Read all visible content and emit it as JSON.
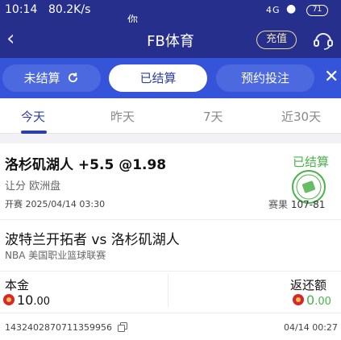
{
  "status_bar": {
    "time": "10:14",
    "speed": "80.2K/s",
    "overlay_text": "你",
    "signal": "4G",
    "battery": "71"
  },
  "header": {
    "title": "FB体育",
    "recharge_label": "充值",
    "back_icon": "chevron-left-icon",
    "service_icon": "headset-icon"
  },
  "filters": {
    "items": [
      {
        "label": "未结算",
        "active": false
      },
      {
        "label": "已结算",
        "active": true
      },
      {
        "label": "预约投注",
        "active": false
      }
    ],
    "close_icon": "close-icon"
  },
  "date_tabs": [
    {
      "label": "今天",
      "active": true
    },
    {
      "label": "昨天",
      "active": false
    },
    {
      "label": "7天",
      "active": false
    },
    {
      "label": "近30天",
      "active": false
    }
  ],
  "bet": {
    "selection": "洛杉矶湖人 +5.5 @1.98",
    "status": "已结算",
    "bet_type": "让分 欧洲盘",
    "start_time_label": "开赛",
    "start_time": "2025/04/14 03:30",
    "result_label": "赛果",
    "result_score": "107-81",
    "match": "波特兰开拓者 vs 洛杉矶湖人",
    "league": "NBA 美国职业篮球联赛",
    "principal_label": "本金",
    "principal_int": "10",
    "principal_dec": ".00",
    "refund_label": "返还额",
    "refund_int": "0",
    "refund_dec": ".00",
    "order_id": "1432402870711359956",
    "order_time": "04/14 00:27",
    "colors": {
      "accent": "#2b3fa8",
      "header": "#262f8c",
      "filter_bar": "#3554d9",
      "settled": "#4bb14b"
    }
  }
}
